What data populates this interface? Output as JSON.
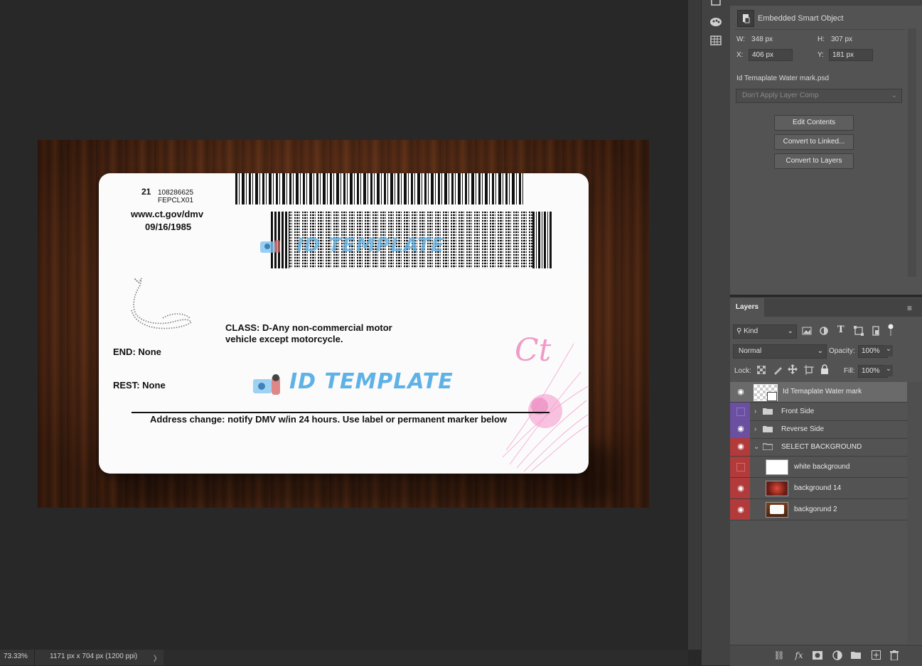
{
  "document": {
    "card": {
      "class_code": "21",
      "doc_number": "108286625",
      "issuer_code": "FEPCLX01",
      "website": "www.ct.gov/dmv",
      "date": "09/16/1985",
      "class_text_line1": "CLASS: D-Any non-commercial motor",
      "class_text_line2": "vehicle except motorcycle.",
      "end_text": "END: None",
      "rest_text": "REST: None",
      "address_note": "Address change: notify DMV w/in 24 hours. Use label or permanent marker below",
      "watermark_text": "ID TEMPLATE",
      "seal_text": "Ct"
    }
  },
  "status_bar": {
    "zoom": "73.33%",
    "doc_info": "1171 px x 704 px (1200 ppi)",
    "arrow": "〉"
  },
  "properties": {
    "object_type": "Embedded Smart Object",
    "w_label": "W:",
    "w_value": "348 px",
    "h_label": "H:",
    "h_value": "307 px",
    "x_label": "X:",
    "x_value": "406 px",
    "y_label": "Y:",
    "y_value": "181 px",
    "file_name": "Id Temaplate Water mark.psd",
    "layer_comp": "Don't Apply Layer Comp",
    "buttons": [
      "Edit Contents",
      "Convert to Linked...",
      "Convert to Layers"
    ]
  },
  "layers_panel": {
    "tab_label": "Layers",
    "filter_kind": "Kind",
    "blend_mode": "Normal",
    "opacity_label": "Opacity:",
    "opacity_value": "100%",
    "lock_label": "Lock:",
    "fill_label": "Fill:",
    "fill_value": "100%",
    "layers": [
      {
        "name": "Id Temaplate Water mark",
        "visible": true
      },
      {
        "name": "Front Side",
        "visible": false
      },
      {
        "name": "Reverse Side",
        "visible": true
      },
      {
        "name": "SELECT BACKGROUND",
        "visible": true
      },
      {
        "name": "white background",
        "visible": false
      },
      {
        "name": "background 14",
        "visible": true
      },
      {
        "name": "backgorund 2",
        "visible": true
      }
    ]
  },
  "colors": {
    "group_purple": "#6b4fa0",
    "group_red": "#b23a3a",
    "selected_row": "#6a6a6a",
    "accent_blue": "#5fb2e6"
  }
}
